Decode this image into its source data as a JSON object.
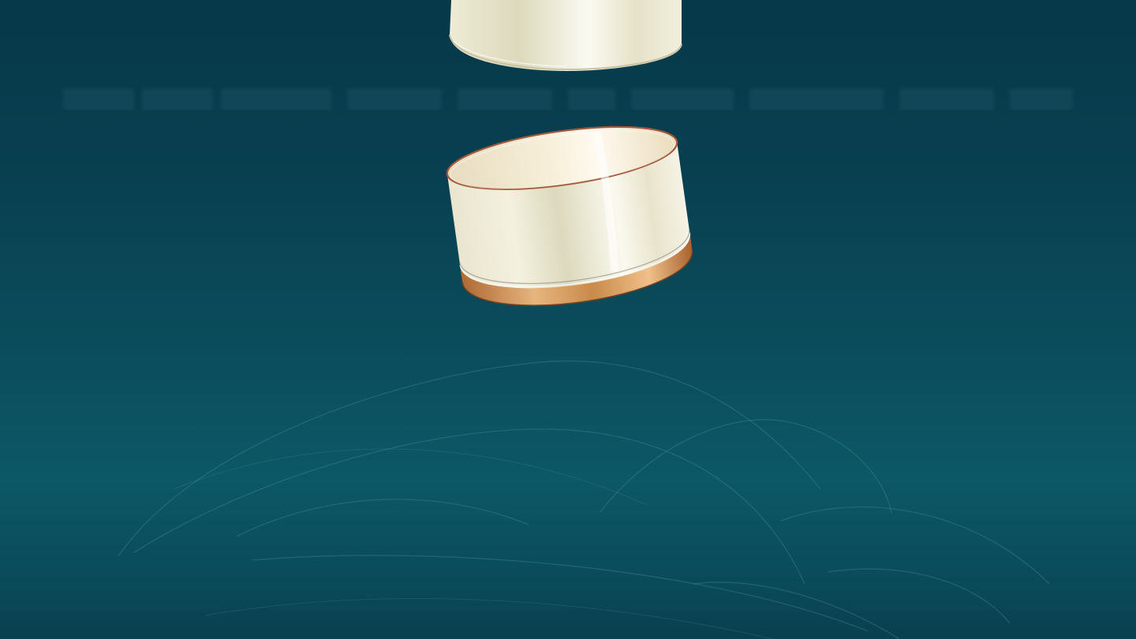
{
  "scene": {
    "description_kind": "product-render",
    "background_color_top": "#06394a",
    "background_color_bottom": "#0c5866",
    "accent_gold": "#c98a4a",
    "cream": "#f2ecd8"
  },
  "objects": {
    "lid": "jar-lid",
    "jar": "jar-base",
    "decor": "swirl-lines"
  }
}
